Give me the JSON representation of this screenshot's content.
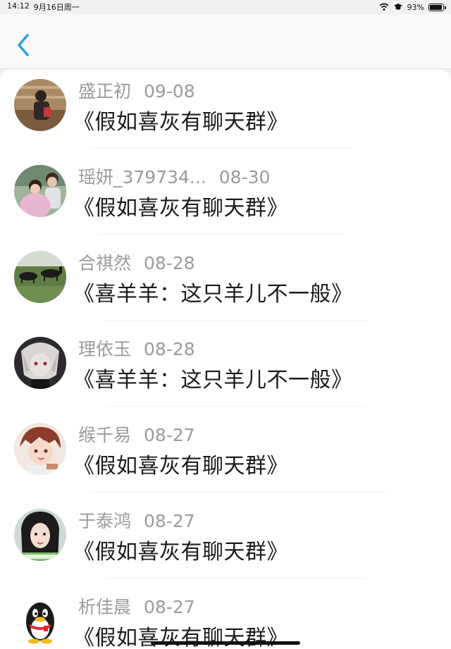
{
  "status_bar": {
    "time": "14:12",
    "date": "9月16日周一",
    "battery": "93%",
    "battery_level": 0.93
  },
  "nav": {
    "accent_color": "#2a9ff0"
  },
  "items": [
    {
      "name": "盛正初",
      "date": "09-08",
      "title": "《假如喜灰有聊天群》",
      "avatar": "avatar-photo-icon"
    },
    {
      "name": "瑶妍_379734...",
      "date": "08-30",
      "title": "《假如喜灰有聊天群》",
      "avatar": "avatar-photo-icon"
    },
    {
      "name": "合祺然",
      "date": "08-28",
      "title": "《喜羊羊：这只羊儿不一般》",
      "avatar": "avatar-horses-icon"
    },
    {
      "name": "理依玉",
      "date": "08-28",
      "title": "《喜羊羊：这只羊儿不一般》",
      "avatar": "avatar-anime-icon"
    },
    {
      "name": "缑千易",
      "date": "08-27",
      "title": "《假如喜灰有聊天群》",
      "avatar": "avatar-anime-icon"
    },
    {
      "name": "于泰鸿",
      "date": "08-27",
      "title": "《假如喜灰有聊天群》",
      "avatar": "avatar-portrait-icon"
    },
    {
      "name": "析佳晨",
      "date": "08-27",
      "title": "《假如喜灰有聊天群》",
      "avatar": "penguin-icon"
    }
  ]
}
